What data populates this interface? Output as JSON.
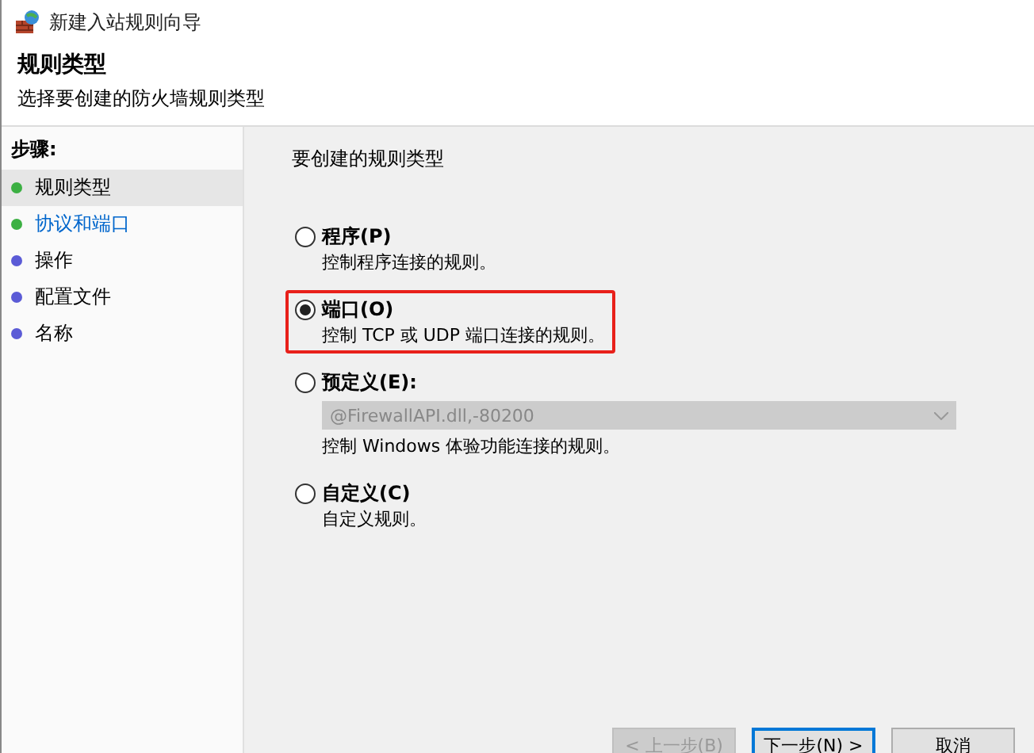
{
  "window": {
    "title": "新建入站规则向导"
  },
  "header": {
    "title": "规则类型",
    "subtitle": "选择要创建的防火墙规则类型"
  },
  "steps": {
    "heading": "步骤:",
    "items": [
      {
        "label": "规则类型",
        "color": "#3cb043",
        "selected": true,
        "hovered": false
      },
      {
        "label": "协议和端口",
        "color": "#3cb043",
        "selected": false,
        "hovered": true
      },
      {
        "label": "操作",
        "color": "#5b5bd6",
        "selected": false,
        "hovered": false
      },
      {
        "label": "配置文件",
        "color": "#5b5bd6",
        "selected": false,
        "hovered": false
      },
      {
        "label": "名称",
        "color": "#5b5bd6",
        "selected": false,
        "hovered": false
      }
    ]
  },
  "prompt": "要创建的规则类型",
  "options": [
    {
      "label": "程序(P)",
      "description": "控制程序连接的规则。",
      "selected": false,
      "highlighted": false
    },
    {
      "label": "端口(O)",
      "description": "控制 TCP 或 UDP 端口连接的规则。",
      "selected": true,
      "highlighted": true
    },
    {
      "label": "预定义(E):",
      "dropdown": {
        "value": "@FirewallAPI.dll,-80200",
        "disabled": true
      },
      "description": "控制 Windows 体验功能连接的规则。",
      "selected": false,
      "highlighted": false
    },
    {
      "label": "自定义(C)",
      "description": "自定义规则。",
      "selected": false,
      "highlighted": false
    }
  ],
  "buttons": [
    {
      "label": "< 上一步(B)",
      "disabled": true,
      "default": false
    },
    {
      "label": "下一步(N) >",
      "disabled": false,
      "default": true
    },
    {
      "label": "取消",
      "disabled": false,
      "default": false
    }
  ]
}
